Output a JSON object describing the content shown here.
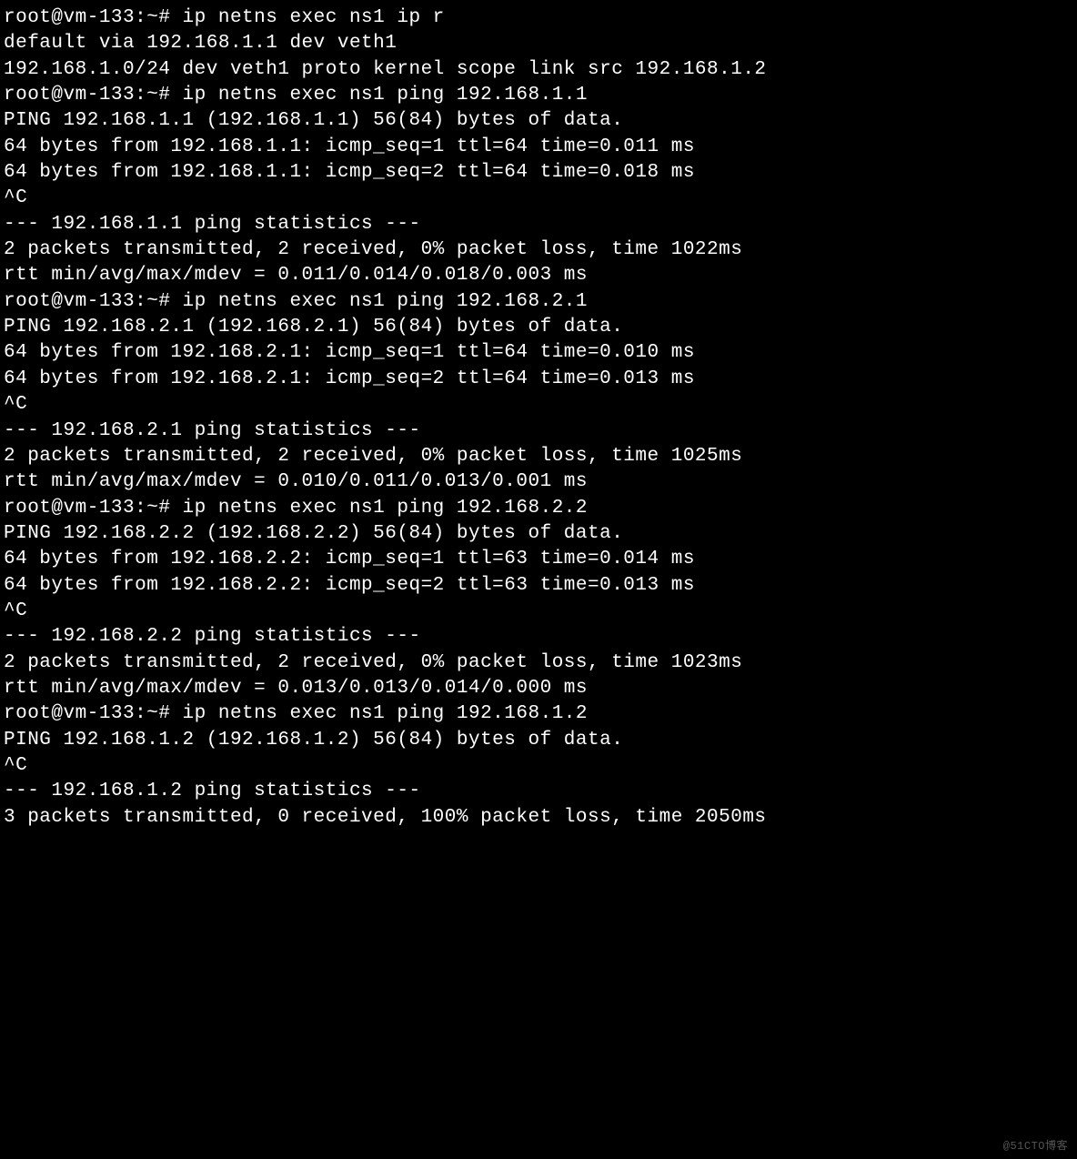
{
  "terminal": {
    "lines": [
      "root@vm-133:~# ip netns exec ns1 ip r",
      "default via 192.168.1.1 dev veth1",
      "192.168.1.0/24 dev veth1 proto kernel scope link src 192.168.1.2",
      "root@vm-133:~# ip netns exec ns1 ping 192.168.1.1",
      "PING 192.168.1.1 (192.168.1.1) 56(84) bytes of data.",
      "64 bytes from 192.168.1.1: icmp_seq=1 ttl=64 time=0.011 ms",
      "64 bytes from 192.168.1.1: icmp_seq=2 ttl=64 time=0.018 ms",
      "^C",
      "--- 192.168.1.1 ping statistics ---",
      "2 packets transmitted, 2 received, 0% packet loss, time 1022ms",
      "rtt min/avg/max/mdev = 0.011/0.014/0.018/0.003 ms",
      "root@vm-133:~# ip netns exec ns1 ping 192.168.2.1",
      "PING 192.168.2.1 (192.168.2.1) 56(84) bytes of data.",
      "64 bytes from 192.168.2.1: icmp_seq=1 ttl=64 time=0.010 ms",
      "64 bytes from 192.168.2.1: icmp_seq=2 ttl=64 time=0.013 ms",
      "^C",
      "--- 192.168.2.1 ping statistics ---",
      "2 packets transmitted, 2 received, 0% packet loss, time 1025ms",
      "rtt min/avg/max/mdev = 0.010/0.011/0.013/0.001 ms",
      "root@vm-133:~# ip netns exec ns1 ping 192.168.2.2",
      "PING 192.168.2.2 (192.168.2.2) 56(84) bytes of data.",
      "64 bytes from 192.168.2.2: icmp_seq=1 ttl=63 time=0.014 ms",
      "64 bytes from 192.168.2.2: icmp_seq=2 ttl=63 time=0.013 ms",
      "^C",
      "--- 192.168.2.2 ping statistics ---",
      "2 packets transmitted, 2 received, 0% packet loss, time 1023ms",
      "rtt min/avg/max/mdev = 0.013/0.013/0.014/0.000 ms",
      "root@vm-133:~# ip netns exec ns1 ping 192.168.1.2",
      "PING 192.168.1.2 (192.168.1.2) 56(84) bytes of data.",
      "^C",
      "--- 192.168.1.2 ping statistics ---",
      "3 packets transmitted, 0 received, 100% packet loss, time 2050ms"
    ]
  },
  "watermark": "@51CTO博客"
}
